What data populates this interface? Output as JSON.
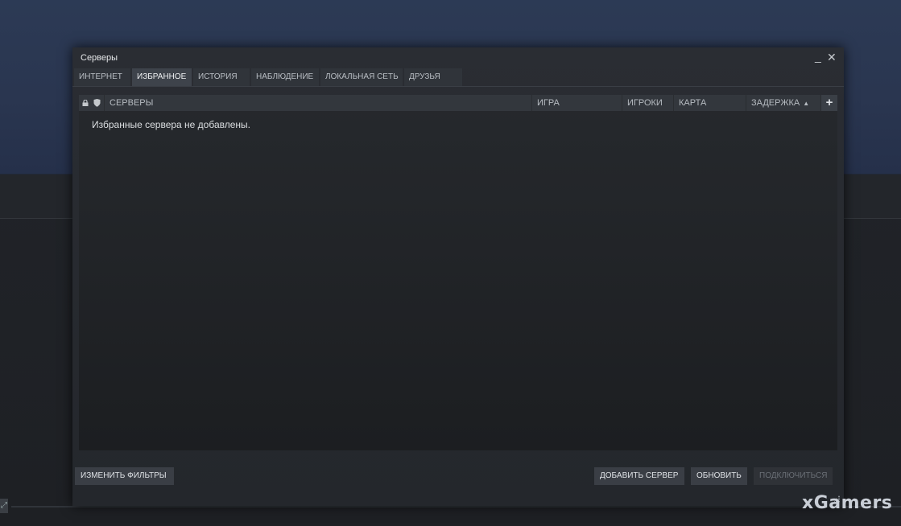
{
  "window": {
    "title": "Серверы",
    "minimize_glyph": "_",
    "close_glyph": "✕"
  },
  "tabs": [
    {
      "label": "ИНТЕРНЕТ",
      "active": false
    },
    {
      "label": "ИЗБРАННОЕ",
      "active": true
    },
    {
      "label": "ИСТОРИЯ",
      "active": false
    },
    {
      "label": "НАБЛЮДЕНИЕ",
      "active": false
    },
    {
      "label": "ЛОКАЛЬНАЯ СЕТЬ",
      "active": false
    },
    {
      "label": "ДРУЗЬЯ",
      "active": false
    }
  ],
  "columns": {
    "password_icon": "lock-icon",
    "secure_icon": "shield-icon",
    "servers": "СЕРВЕРЫ",
    "game": "ИГРА",
    "players": "ИГРОКИ",
    "map": "КАРТА",
    "latency": "ЗАДЕРЖКА",
    "latency_sort": "▲",
    "add_column": "+"
  },
  "list": {
    "empty_message": "Избранные сервера не добавлены."
  },
  "buttons": {
    "change_filters": "ИЗМЕНИТЬ ФИЛЬТРЫ",
    "add_server": "ДОБАВИТЬ СЕРВЕР",
    "refresh": "ОБНОВИТЬ",
    "connect": "ПОДКЛЮЧИТЬСЯ"
  },
  "watermark": "xGamers",
  "colors": {
    "window_bg": "#2a2d33",
    "tab_active": "#3e434b",
    "header_bg": "#33373d",
    "disabled_text": "#6a6f76"
  }
}
